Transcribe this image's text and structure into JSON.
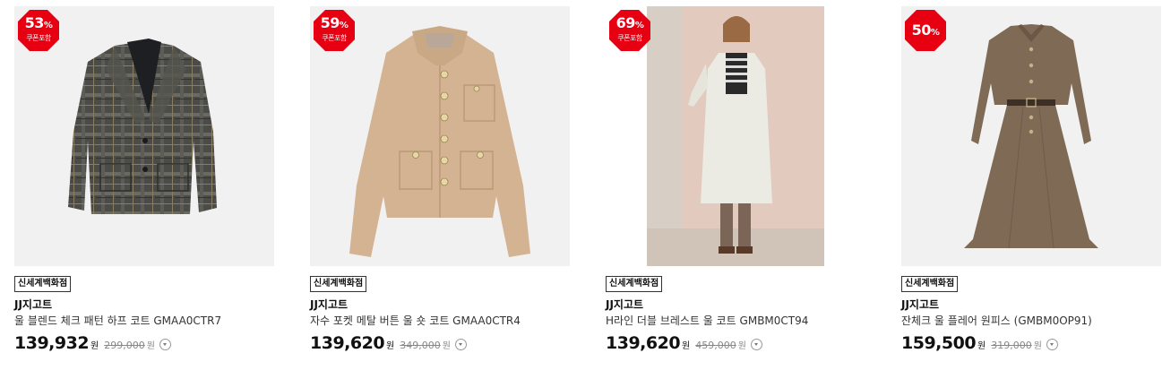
{
  "colors": {
    "badge": "#e60012",
    "thumb_bg": "#f1f1f1"
  },
  "products": [
    {
      "badge_rate": "53",
      "badge_sub": "쿠폰포함",
      "image": "plaid-half-coat",
      "store": "신세계백화점",
      "brand": "JJ지고트",
      "name": "울 블렌드 체크 패턴 하프 코트 GMAA0CTR7",
      "price": "139,932",
      "won": "원",
      "original_price": "299,000",
      "original_won": "원"
    },
    {
      "badge_rate": "59",
      "badge_sub": "쿠폰포함",
      "image": "beige-short-jacket",
      "store": "신세계백화점",
      "brand": "JJ지고트",
      "name": "자수 포켓 메탈 버튼 울 숏 코트 GMAA0CTR4",
      "price": "139,620",
      "won": "원",
      "original_price": "349,000",
      "original_won": "원"
    },
    {
      "badge_rate": "69",
      "badge_sub": "쿠폰포함",
      "image": "model-ivory-long-coat",
      "store": "신세계백화점",
      "brand": "JJ지고트",
      "name": "H라인 더블 브레스트 울 코트 GMBM0CT94",
      "price": "139,620",
      "won": "원",
      "original_price": "459,000",
      "original_won": "원"
    },
    {
      "badge_rate": "50",
      "badge_sub": "",
      "image": "brown-check-dress",
      "store": "신세계백화점",
      "brand": "JJ지고트",
      "name": "잔체크 울 플레어 원피스 (GMBM0OP91)",
      "price": "159,500",
      "won": "원",
      "original_price": "319,000",
      "original_won": "원"
    }
  ],
  "pct_sign": "%"
}
